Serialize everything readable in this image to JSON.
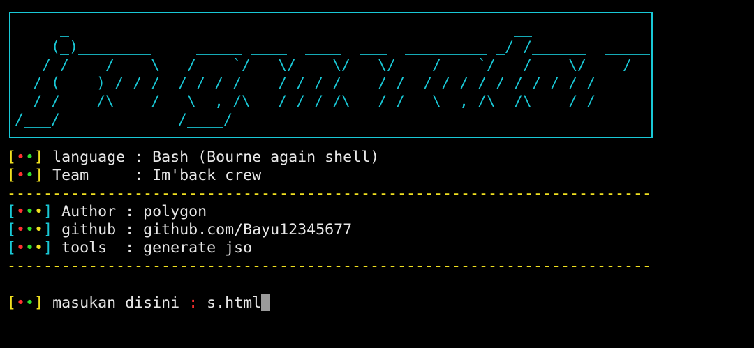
{
  "banner": {
    "ascii_art": [
      "     _                                                 __",
      "    (_)________     _____ ____  ____  ___  _________ _/ /______  _____",
      "   / / ___/ __ \\   / __ `/ _ \\/ __ \\/ _ \\/ ___/ __ `/ __/ __ \\/ ___/",
      "  / (__  ) /_/ /  / /_/ /  __/ / / /  __/ /  / /_/ / /_/ /_/ / /",
      "__/ /____/\\____/   \\__, /\\___/_/ /_/\\___/_/   \\__,_/\\__/\\____/_/",
      "/___/             /____/"
    ]
  },
  "info": {
    "language_key": "language",
    "language_sep": " : ",
    "language_value": "Bash (Bourne again shell)",
    "team_key": "Team",
    "team_sep": "     : ",
    "team_value": "Im'back crew"
  },
  "separator": "-----------------------------------------------------------------------",
  "credits": {
    "author_key": "Author",
    "author_sep": " : ",
    "author_value": "polygon",
    "github_key": "github",
    "github_sep": " : ",
    "github_value": "github.com/Bayu12345677",
    "tools_key": "tools",
    "tools_sep": "  : ",
    "tools_value": "generate jso"
  },
  "prompt": {
    "label": "masukan disini",
    "colon": ":",
    "input_value": "s.html"
  },
  "colors": {
    "cyan": "#19c8d6",
    "yellow": "#f0e020",
    "red": "#ff3030",
    "green": "#30e030"
  }
}
